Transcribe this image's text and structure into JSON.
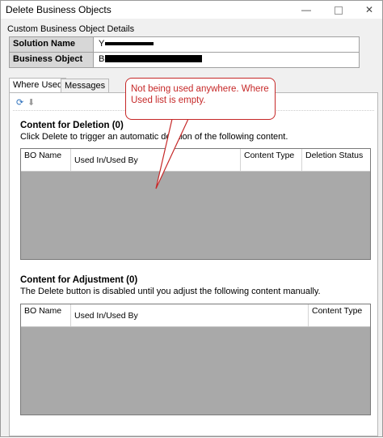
{
  "window": {
    "title": "Delete Business Objects",
    "min_glyph": "—",
    "close_glyph": "✕"
  },
  "details": {
    "caption": "Custom Business Object Details",
    "rows": [
      {
        "label": "Solution Name",
        "value": "Y"
      },
      {
        "label": "Business Object",
        "value": "B"
      }
    ]
  },
  "tabs": [
    {
      "label": "Where Used",
      "active": true
    },
    {
      "label": "Messages",
      "active": false
    }
  ],
  "toolbar": {
    "refresh_icon": "refresh-icon",
    "down_icon": "arrow-down-icon"
  },
  "deletion": {
    "title": "Content for Deletion (0)",
    "description": "Click Delete to trigger an automatic deletion of the following content.",
    "columns": [
      "BO Name",
      "Used In/Used By",
      "Content Type",
      "Deletion Status"
    ]
  },
  "adjustment": {
    "title": "Content for Adjustment (0)",
    "description": "The Delete button is disabled until you adjust the following content manually.",
    "columns": [
      "BO Name",
      "Used In/Used By",
      "Content Type"
    ]
  },
  "annotation": {
    "text": "Not being used anywhere. Where Used list is empty.",
    "color": "#c62828"
  },
  "colors": {
    "grid_empty": "#a9a9a9",
    "label_bg": "#d7d7d7"
  }
}
